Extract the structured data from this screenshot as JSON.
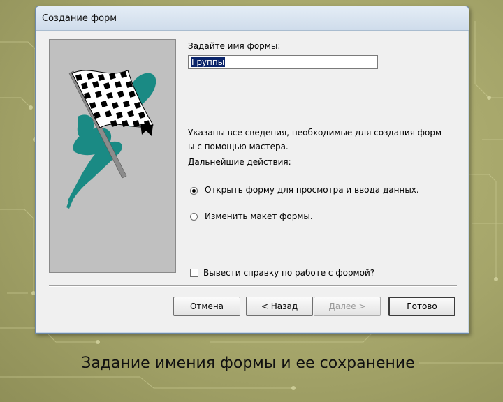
{
  "dialog": {
    "title": "Создание форм",
    "form_name_prompt": "Задайте имя формы:",
    "form_name_value": "Группы",
    "info_text_line1": "Указаны все сведения, необходимые для создания форм",
    "info_text_line2": "ы с помощью мастера.",
    "next_actions_label": "Дальнейшие действия:",
    "options": [
      {
        "label": "Открыть форму для просмотра и ввода данных.",
        "checked": true
      },
      {
        "label": "Изменить макет формы.",
        "checked": false
      }
    ],
    "help_checkbox_label": "Вывести справку по работе с формой?",
    "help_checked": false,
    "buttons": {
      "cancel": "Отмена",
      "back": "< Назад",
      "next": "Далее >",
      "finish": "Готово"
    },
    "wizard_image_icon": "checkered-flag-icon"
  },
  "slide_caption": "Задание имения формы и ее сохранение",
  "colors": {
    "flag_teal": "#1a8a84",
    "selection": "#0a246a"
  }
}
